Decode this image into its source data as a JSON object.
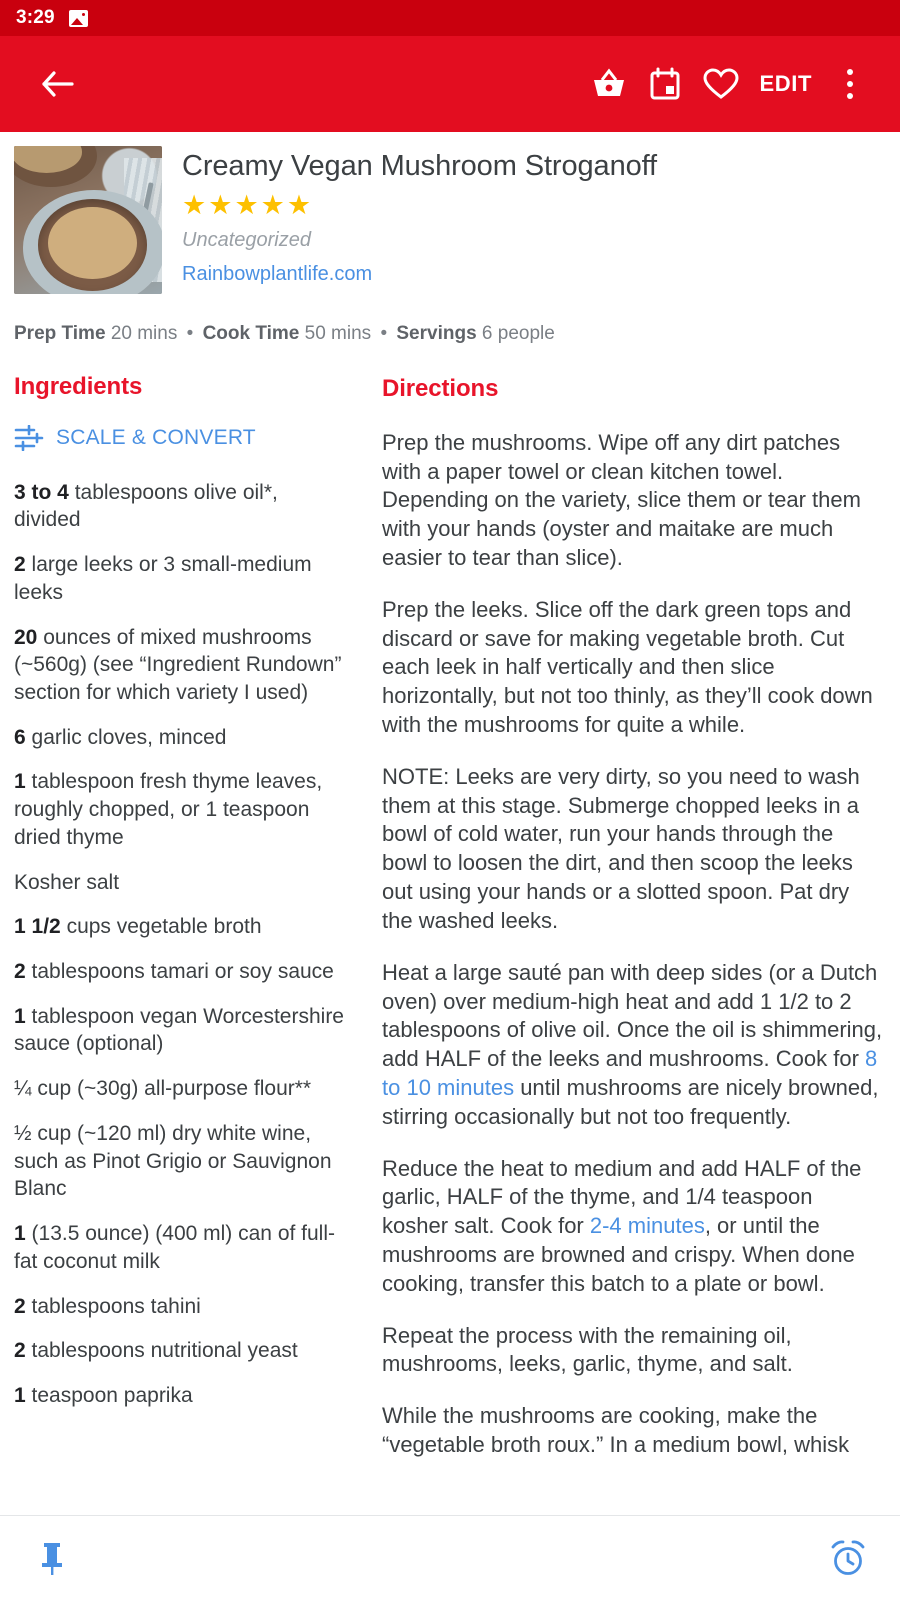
{
  "status_bar": {
    "time": "3:29",
    "icons": [
      "image-icon"
    ]
  },
  "app_bar": {
    "back_icon": "back-arrow-icon",
    "basket_icon": "shopping-basket-icon",
    "calendar_icon": "calendar-icon",
    "favorite_icon": "heart-outline-icon",
    "edit_label": "EDIT",
    "overflow_icon": "more-vertical-icon",
    "background_color": "#e30d20"
  },
  "recipe": {
    "title": "Creamy Vegan Mushroom Stroganoff",
    "rating": 5,
    "rating_star_color": "#fdc000",
    "category": "Uncategorized",
    "source": "Rainbowplantlife.com",
    "meta": {
      "prep_label": "Prep Time",
      "prep_value": "20 mins",
      "cook_label": "Cook Time",
      "cook_value": "50 mins",
      "servings_label": "Servings",
      "servings_value": "6 people",
      "separator": "•"
    }
  },
  "ingredients": {
    "heading": "Ingredients",
    "scale_convert_label": "SCALE & CONVERT",
    "scale_icon": "tune-sliders-icon",
    "items": [
      {
        "qty": "3 to 4",
        "text": "tablespoons olive oil*, divided"
      },
      {
        "qty": "2",
        "text": "large leeks or 3 small-medium leeks"
      },
      {
        "qty": "20",
        "text": "ounces of mixed mushrooms (~560g) (see “Ingredient Rundown” section for which variety I used)"
      },
      {
        "qty": "6",
        "text": "garlic cloves, minced"
      },
      {
        "qty": "1",
        "text": "tablespoon fresh thyme leaves, roughly chopped, or 1 teaspoon dried thyme"
      },
      {
        "qty": "",
        "text": "Kosher salt"
      },
      {
        "qty": "1 1/2",
        "text": "cups vegetable broth"
      },
      {
        "qty": "2",
        "text": "tablespoons tamari or soy sauce"
      },
      {
        "qty": "1",
        "text": "tablespoon vegan Worcestershire sauce (optional)"
      },
      {
        "qty": "",
        "text": "¼ cup (~30g) all-purpose flour**"
      },
      {
        "qty": "",
        "text": "½ cup (~120 ml) dry white wine, such as Pinot Grigio or Sauvignon Blanc"
      },
      {
        "qty": "1",
        "text": "(13.5 ounce) (400 ml) can of full-fat coconut milk"
      },
      {
        "qty": "2",
        "text": "tablespoons tahini"
      },
      {
        "qty": "2",
        "text": "tablespoons nutritional yeast"
      },
      {
        "qty": "1",
        "text": "teaspoon paprika"
      }
    ]
  },
  "directions": {
    "heading": "Directions",
    "paragraphs": [
      {
        "before": "Prep the mushrooms. Wipe off any dirt patches with a paper towel or clean kitchen towel. Depending on the variety, slice them or tear them with your hands (oyster and maitake are much easier to tear than slice).",
        "link": "",
        "after": ""
      },
      {
        "before": "Prep the leeks. Slice off the dark green tops and discard or save for making vegetable broth. Cut each leek in half vertically and then slice horizontally, but not too thinly, as they’ll cook down with the mushrooms for quite a while.",
        "link": "",
        "after": ""
      },
      {
        "before": "NOTE: Leeks are very dirty, so you need to wash them at this stage. Submerge chopped leeks in a bowl of cold water, run your hands through the bowl to loosen the dirt, and then scoop the leeks out using your hands or a slotted spoon. Pat dry the washed leeks.",
        "link": "",
        "after": ""
      },
      {
        "before": "Heat a large sauté pan with deep sides (or a Dutch oven) over medium-high heat and add 1 1/2 to 2 tablespoons of olive oil. Once the oil is shimmering, add HALF of the leeks and mushrooms. Cook for ",
        "link": "8 to 10 minutes",
        "after": " until mushrooms are nicely browned, stirring occasionally but not too frequently."
      },
      {
        "before": "Reduce the heat to medium and add HALF of the garlic, HALF of the thyme, and 1/4 teaspoon kosher salt. Cook for ",
        "link": "2-4 minutes",
        "after": ", or until the mushrooms are browned and crispy. When done cooking, transfer this batch to a plate or bowl."
      },
      {
        "before": "Repeat the process with the remaining oil, mushrooms, leeks, garlic, thyme, and salt.",
        "link": "",
        "after": ""
      },
      {
        "before": "While the mushrooms are cooking, make the “vegetable broth roux.” In a medium bowl, whisk",
        "link": "",
        "after": ""
      }
    ],
    "timer_link_color": "#4a90e2"
  },
  "bottom_bar": {
    "pin_icon": "pushpin-icon",
    "timer_icon": "alarm-clock-icon",
    "icon_color": "#4a90e2"
  }
}
